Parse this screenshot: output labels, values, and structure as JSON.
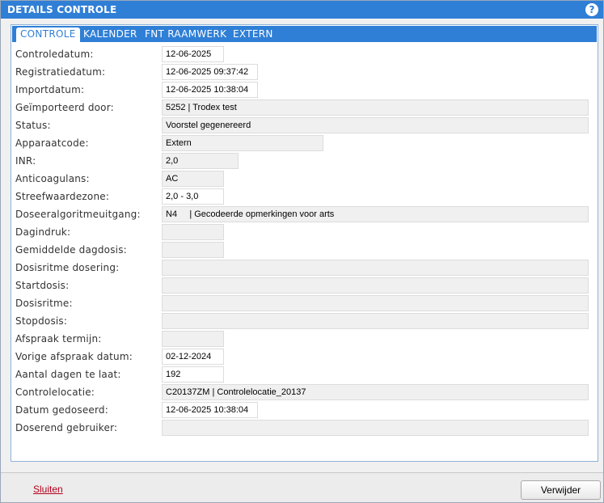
{
  "dialog": {
    "title": "DETAILS CONTROLE",
    "help_glyph": "?"
  },
  "tabs": [
    {
      "label": "CONTROLE",
      "active": true
    },
    {
      "label": "KALENDER",
      "active": false
    },
    {
      "label": "FNT RAAMWERK",
      "active": false
    },
    {
      "label": "EXTERN",
      "active": false
    }
  ],
  "fields": [
    {
      "label": "Controledatum:",
      "value": "12-06-2025"
    },
    {
      "label": "Registratiedatum:",
      "value": "12-06-2025 09:37:42"
    },
    {
      "label": "Importdatum:",
      "value": "12-06-2025 10:38:04"
    },
    {
      "label": "Geïmporteerd door:",
      "value": "5252 | Trodex test"
    },
    {
      "label": "Status:",
      "value": "Voorstel gegenereerd"
    },
    {
      "label": "Apparaatcode:",
      "value": "Extern"
    },
    {
      "label": "INR:",
      "value": "2,0"
    },
    {
      "label": "Anticoagulans:",
      "value": "AC"
    },
    {
      "label": "Streefwaardezone:",
      "value": "2,0 - 3,0"
    },
    {
      "label": "Doseeralgoritmeuitgang:",
      "value": "N4     | Gecodeerde opmerkingen voor arts"
    },
    {
      "label": "Dagindruk:",
      "value": ""
    },
    {
      "label": "Gemiddelde dagdosis:",
      "value": ""
    },
    {
      "label": "Dosisritme dosering:",
      "value": ""
    },
    {
      "label": "Startdosis:",
      "value": ""
    },
    {
      "label": "Dosisritme:",
      "value": ""
    },
    {
      "label": "Stopdosis:",
      "value": ""
    },
    {
      "label": "Afspraak termijn:",
      "value": ""
    },
    {
      "label": "Vorige afspraak datum:",
      "value": "02-12-2024"
    },
    {
      "label": "Aantal dagen te laat:",
      "value": "192"
    },
    {
      "label": "Controlelocatie:",
      "value": "C20137ZM | Controlelocatie_20137"
    },
    {
      "label": "Datum gedoseerd:",
      "value": "12-06-2025 10:38:04"
    },
    {
      "label": "Doserend gebruiker:",
      "value": ""
    }
  ],
  "footer": {
    "close_label": "Sluiten",
    "delete_label": "Verwijder"
  },
  "colors": {
    "accent": "#2f7fd6",
    "link": "#b3001b"
  }
}
